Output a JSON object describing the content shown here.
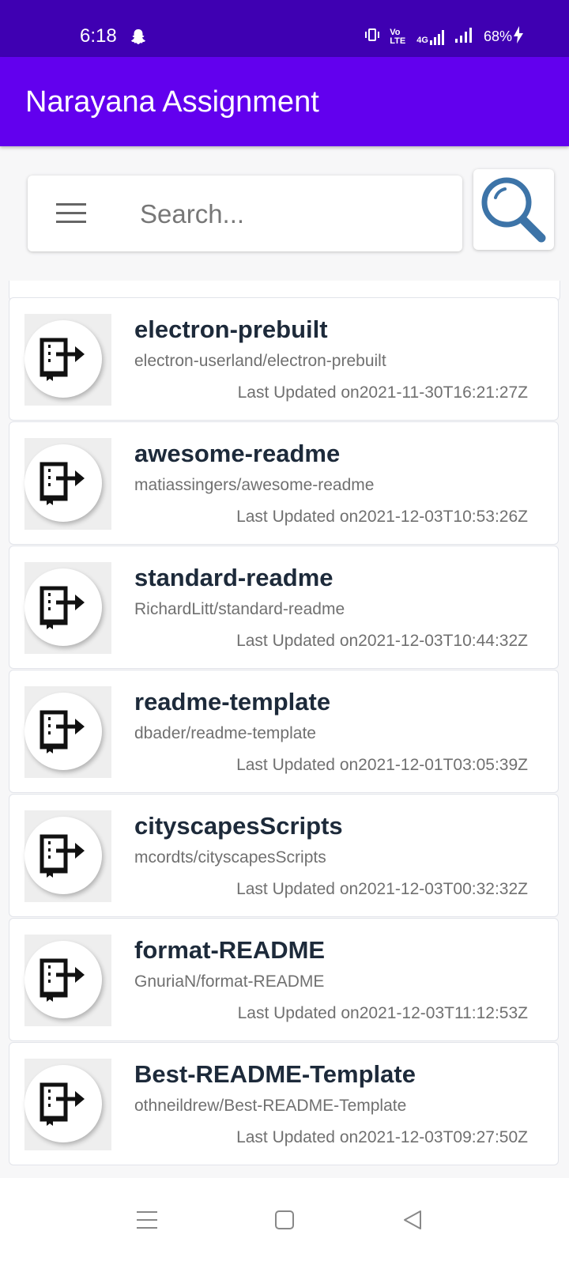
{
  "status_bar": {
    "time": "6:18",
    "network": "4G",
    "volte": "Vo LTE",
    "battery": "68%"
  },
  "app_bar": {
    "title": "Narayana Assignment"
  },
  "search": {
    "placeholder": "Search..."
  },
  "repos": [
    {
      "name": "electron-prebuilt",
      "full_name": "electron-userland/electron-prebuilt",
      "updated": "Last Updated on2021-11-30T16:21:27Z"
    },
    {
      "name": "awesome-readme",
      "full_name": "matiassingers/awesome-readme",
      "updated": "Last Updated on2021-12-03T10:53:26Z"
    },
    {
      "name": "standard-readme",
      "full_name": "RichardLitt/standard-readme",
      "updated": "Last Updated on2021-12-03T10:44:32Z"
    },
    {
      "name": "readme-template",
      "full_name": "dbader/readme-template",
      "updated": "Last Updated on2021-12-01T03:05:39Z"
    },
    {
      "name": "cityscapesScripts",
      "full_name": "mcordts/cityscapesScripts",
      "updated": "Last Updated on2021-12-03T00:32:32Z"
    },
    {
      "name": "format-README",
      "full_name": "GnuriaN/format-README",
      "updated": "Last Updated on2021-12-03T11:12:53Z"
    },
    {
      "name": "Best-README-Template",
      "full_name": "othneildrew/Best-README-Template",
      "updated": "Last Updated on2021-12-03T09:27:50Z"
    }
  ],
  "colors": {
    "status_bar": "#3f00b2",
    "app_bar": "#6200ee",
    "search_icon": "#3d74a8"
  }
}
